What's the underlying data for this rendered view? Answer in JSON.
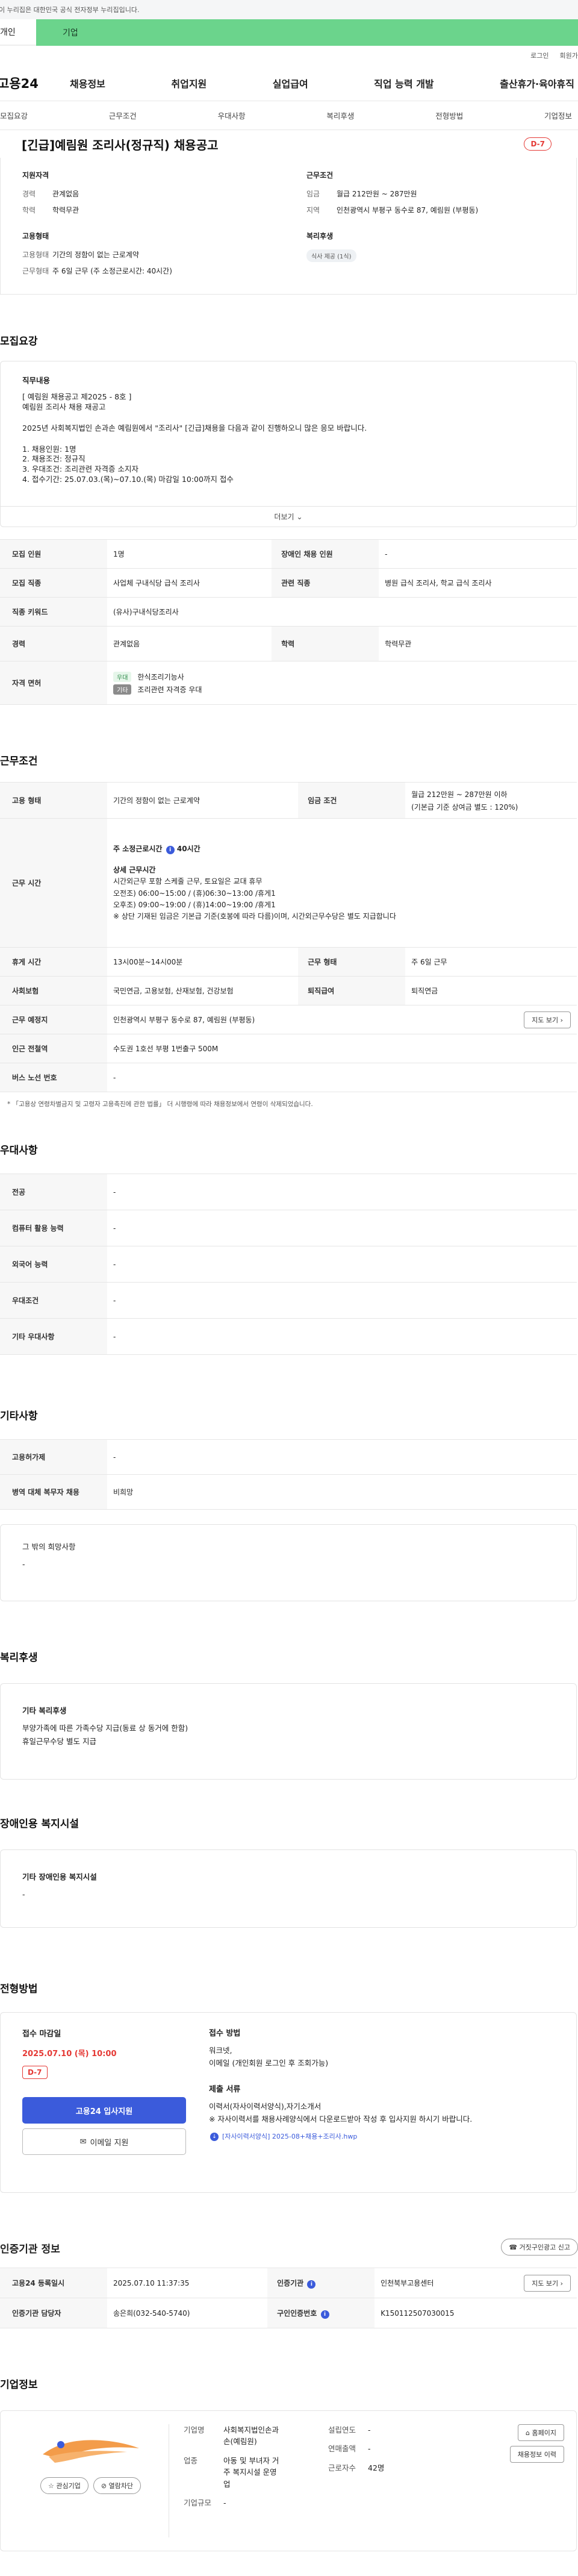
{
  "gov_bar": "이 누리집은 대한민국 공식 전자정부 누리집입니다.",
  "member_tabs": [
    "개인",
    "기업"
  ],
  "util_links": [
    "로그인",
    "회원가입"
  ],
  "logo": "고용24",
  "gnb": [
    "채용정보",
    "취업지원",
    "실업급여",
    "직업 능력 개발",
    "출산휴가·육아휴직"
  ],
  "subnav": [
    "모집요강",
    "근무조건",
    "우대사항",
    "복리후생",
    "전형방법",
    "기업정보"
  ],
  "title": "[긴급]예림원 조리사(정규직) 채용공고",
  "dday": "D-7",
  "summary": {
    "qual_head": "지원자격",
    "career_k": "경력",
    "career_v": "관계없음",
    "edu_k": "학력",
    "edu_v": "학력무관",
    "emp_head": "고용형태",
    "emptype_k": "고용형태",
    "emptype_v": "기간의 정함이 없는 근로계약",
    "worktype_k": "근무형태",
    "worktype_v": "주 6일 근무 (주 소정근로시간: 40시간)",
    "cond_head": "근무조건",
    "wage_k": "임금",
    "wage_v": "월급 212만원 ~ 287만원",
    "region_k": "지역",
    "region_v": "인천광역시 부평구 동수로 87, 예림원 (부평동)",
    "welfare_head": "복리후생",
    "welfare_chip": "식사 제공 (1식)"
  },
  "sections": {
    "recruit": "모집요강",
    "work": "근무조건",
    "pref": "우대사항",
    "etc": "기타사항",
    "welfare": "복리후생",
    "disabled": "장애인용 복지시설",
    "process": "전형방법",
    "cert": "인증기관 정보",
    "company": "기업정보"
  },
  "job_desc": {
    "title": "직무내용",
    "l1": "[ 예림원 채용공고 제2025 - 8호 ]",
    "l2": "예림원 조리사 채용 재공고",
    "l3": "2025년 사회복지법인 손과손 예림원에서 \"조리사\" [긴급]채용을 다음과 같이 진행하오니 많은 응모 바랍니다.",
    "l4": "1. 채용인원: 1명",
    "l5": "2. 채용조건: 정규직",
    "l6": "3. 우대조건: 조리관련 자격증 소지자",
    "l7": "4. 접수기간: 25.07.03.(목)~07.10.(목) 마감일 10:00까지 접수",
    "more": "더보기"
  },
  "recruit_table": {
    "count_k": "모집 인원",
    "count_v": "1명",
    "dis_k": "장애인 채용 인원",
    "dis_v": "-",
    "job_k": "모집 직종",
    "job_v": "사업체 구내식당 급식 조리사",
    "rel_k": "관련 직종",
    "rel_v": "병원 급식 조리사, 학교 급식 조리사",
    "kw_k": "직종 키워드",
    "kw_v": "(유사)구내식당조리사",
    "career_k": "경력",
    "career_v": "관계없음",
    "edu_k": "학력",
    "edu_v": "학력무관",
    "cert_k": "자격 면허",
    "cert_tag1": "우대",
    "cert_v1": "한식조리기능사",
    "cert_tag2": "기타",
    "cert_v2": "조리관련 자격증 우대"
  },
  "work_table": {
    "emp_k": "고용 형태",
    "emp_v": "기간의 정함이 없는 근로계약",
    "wage_k": "임금 조건",
    "wage_v1": "월급 212만원 ~ 287만원 이하",
    "wage_v2": "(기본급 기준 상여금 별도 : 120%)",
    "time_k": "근무 시간",
    "time_h1": "주 소정근로시간",
    "time_h1_v": "40시간",
    "time_h2": "상세 근무시간",
    "time_l1": "시간외근무 포함 스케줄 근무, 토요일은 교대 휴무",
    "time_l2": "오전조) 06:00~15:00 / (휴)06:30~13:00 /휴게1",
    "time_l3": "오후조) 09:00~19:00 / (휴)14:00~19:00 /휴게1",
    "time_l4": "※ 상단 기재된 임금은 기본급 기준(호봉에 따라 다름)이며, 시간외근무수당은 별도 지급합니다",
    "rest_k": "휴게 시간",
    "rest_v": "13시00분~14시00분",
    "form_k": "근무 형태",
    "form_v": "주 6일 근무",
    "ins_k": "사회보험",
    "ins_v": "국민연금, 고용보험, 산재보험, 건강보험",
    "ret_k": "퇴직급여",
    "ret_v": "퇴직연금",
    "place_k": "근무 예정지",
    "place_v": "인천광역시 부평구 동수로 87, 예림원 (부평동)",
    "map_btn": "지도 보기",
    "sub_k": "인근 전철역",
    "sub_v": "수도권 1호선 부평 1번출구 500M",
    "bus_k": "버스 노선 번호",
    "bus_v": "-"
  },
  "work_note": "* 「고용상 연령차별금지 및 고령자 고용촉진에 관한 법률」 더 시행령에 따라 채용정보에서 연령이 삭제되었습니다.",
  "pref_table": [
    {
      "k": "전공",
      "v": "-"
    },
    {
      "k": "컴퓨터 활용 능력",
      "v": "-"
    },
    {
      "k": "외국어 능력",
      "v": "-"
    },
    {
      "k": "우대조건",
      "v": "-"
    },
    {
      "k": "기타 우대사항",
      "v": "-"
    }
  ],
  "etc_table": [
    {
      "k": "고용허가제",
      "v": "-"
    },
    {
      "k": "병역 대체 복무자 채용",
      "v": "비희망"
    }
  ],
  "etc_box": {
    "title": "그 밖의 희망사항",
    "v": "-"
  },
  "welfare_box": {
    "title": "기타 복리후생",
    "l1": "부양가족에 따른 가족수당 지급(동료 상 동거에 한함)",
    "l2": "휴일근무수당 별도 지급"
  },
  "disabled_box": {
    "title": "기타 장애인용 복지시설",
    "v": "-"
  },
  "process": {
    "deadline_h": "접수 마감일",
    "deadline_v": "2025.07.10 (목) 10:00",
    "dday": "D-7",
    "apply_btn": "고용24 입사지원",
    "email_btn": "이메일 지원",
    "method_h": "접수 방법",
    "method_l1": "워크넷,",
    "method_l2": "이메일 (개인회원 로그인 후 조회가능)",
    "doc_h": "제출 서류",
    "doc_l1": "이력서(자사이력서양식),자기소개서",
    "doc_l2": "※ 자사이력서를 채용사례양식에서 다운로드받아 작성 후 입사지원 하시기 바랍니다.",
    "file": "[자사이력서양식] 2025-08+채용+조리사.hwp"
  },
  "cert": {
    "btn": "거짓구인광고 신고",
    "date_k": "고용24 등록일시",
    "date_v": "2025.07.10 11:37:35",
    "org_k": "인증기관",
    "org_v": "인천북부고용센터",
    "map_btn": "지도 보기",
    "mgr_k": "인증기관 담당자",
    "mgr_v": "송은희(032-540-5740)",
    "id_k": "구인인증번호",
    "id_v": "K150112507030015"
  },
  "company": {
    "fav_btn": "관심기업",
    "block_btn": "열람차단",
    "name_k": "기업명",
    "name_v1": "사회복지법인손과",
    "name_v2": "손(예림원)",
    "ind_k": "업종",
    "ind_v1": "아동 및 부녀자 거",
    "ind_v2": "주 복지시설 운영",
    "ind_v3": "업",
    "size_k": "기업규모",
    "size_v": "-",
    "est_k": "설립연도",
    "est_v": "-",
    "sales_k": "연매출액",
    "sales_v": "-",
    "emp_k": "근로자수",
    "emp_v": "42명",
    "home_btn": "홈페이지",
    "other_btn": "채용정보 이력"
  }
}
